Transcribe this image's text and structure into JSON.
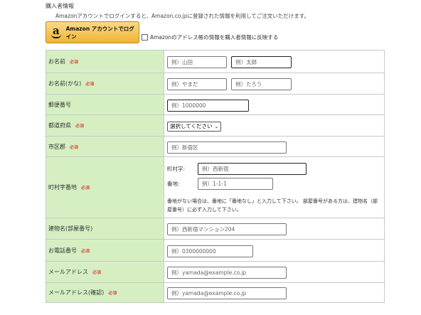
{
  "section_title": "購入者情報",
  "intro_text": "Amazonアカウントでログインすると、Amazon.co.jpに登録された情報を利用してご注文いただけます。",
  "amazon_button": {
    "label": "Amazon アカウントでログイン",
    "logo_letter": "a"
  },
  "sync_checkbox_label": "Amazonのアドレス帳の情報を購入者情報に反映する",
  "required_tag": "必須",
  "rows": {
    "name": {
      "label": "お名前",
      "last_placeholder": "例）山田",
      "first_placeholder": "例）太郎"
    },
    "kana": {
      "label": "お名前(かな)",
      "last_placeholder": "例）やまだ",
      "first_placeholder": "例）たろう"
    },
    "postal": {
      "label": "郵便番号",
      "placeholder": "例）1000000"
    },
    "prefecture": {
      "label": "都道府県",
      "selected": "選択してください"
    },
    "city": {
      "label": "市区郡",
      "placeholder": "例）新宿区"
    },
    "address": {
      "label": "町村字番地",
      "town_label": "町村字:",
      "town_placeholder": "例）西新宿",
      "number_label": "番地:",
      "number_placeholder": "例）1-1-1",
      "note": "番地がない場合は、番地に「番地なし」と入力して下さい。 部屋番号がある方は、建物名（部屋番号）に必ず入力して下さい。"
    },
    "building": {
      "label": "建物名(部屋番号)",
      "placeholder": "例）西新宿マンション204"
    },
    "phone": {
      "label": "お電話番号",
      "placeholder": "例）0300000000"
    },
    "email": {
      "label": "メールアドレス",
      "placeholder": "例）yamada@example.co.jp"
    },
    "email_confirm": {
      "label": "メールアドレス(確認)",
      "placeholder": "例）yamada@example.co.jp"
    }
  }
}
